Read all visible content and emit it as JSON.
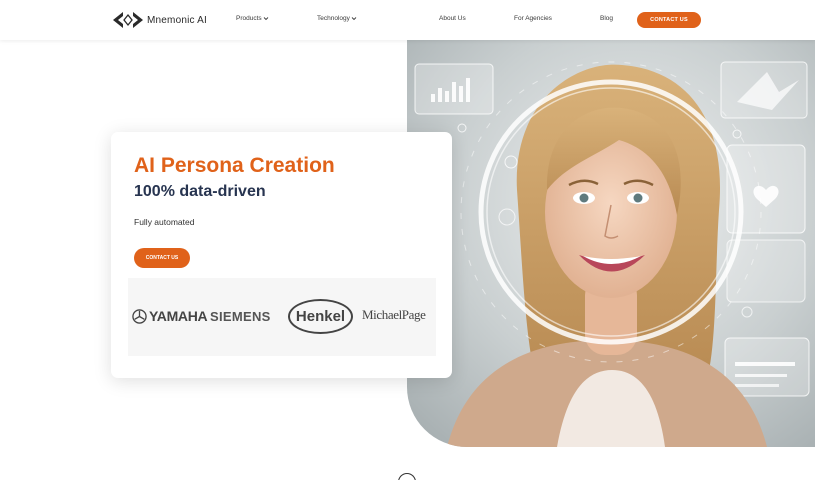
{
  "nav": {
    "brand": "Mnemonic AI",
    "items": [
      {
        "label": "Products",
        "dropdown": true
      },
      {
        "label": "Technology",
        "dropdown": true
      },
      {
        "label": "About Us",
        "dropdown": false
      },
      {
        "label": "For Agencies",
        "dropdown": false
      },
      {
        "label": "Blog",
        "dropdown": false
      }
    ],
    "cta_label": "CONTACT US"
  },
  "hero": {
    "title": "AI Persona Creation",
    "subtitle": "100% data-driven",
    "tagline": "Fully automated",
    "cta_label": "CONTACT US",
    "clients": [
      "YAMAHA",
      "SIEMENS",
      "Henkel",
      "MichaelPage"
    ],
    "image_alt": "Smiling woman surrounded by holographic data interface"
  },
  "colors": {
    "accent": "#e0621a",
    "navy": "#273450",
    "logo_strip_bg": "#f6f6f6"
  },
  "icons": [
    "mnemonic-logo-icon",
    "chevron-down-icon",
    "yamaha-emblem-icon",
    "scroll-down-icon"
  ]
}
